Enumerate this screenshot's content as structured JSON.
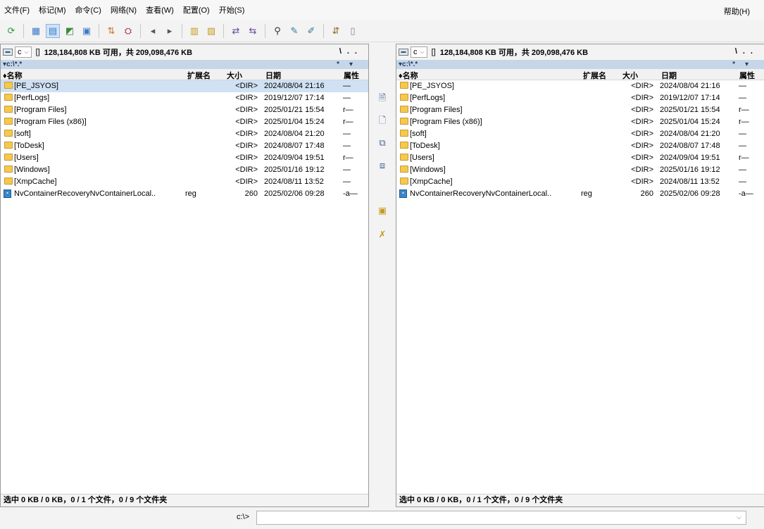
{
  "menu": [
    "文件(F)",
    "标记(M)",
    "命令(C)",
    "网络(N)",
    "查看(W)",
    "配置(O)",
    "开始(S)"
  ],
  "menu_help": "帮助(H)",
  "toolbar_icons": [
    "refresh-icon",
    "brief-view-icon",
    "full-view-icon",
    "tree-icon",
    "thumbnail-icon",
    "sort-icon",
    "filter-icon",
    "back-icon",
    "forward-icon",
    "pack-icon",
    "unpack-icon",
    "compare-icon",
    "sync-icon",
    "search-icon",
    "rename-icon",
    "multi-rename-icon",
    "ftp-icon",
    "notepad-icon"
  ],
  "left": {
    "drive": "c",
    "brackets": "[]",
    "info": "128,184,808 KB 可用，共 209,098,476 KB",
    "root_btn": "\\",
    "up_btn": "..",
    "path": "▾c:\\*.*",
    "star_btn": "*",
    "dd_btn": "▾",
    "headers": {
      "name": "♦名称",
      "ext": "扩展名",
      "size": "大小",
      "date": "日期",
      "attr": "属性"
    },
    "status": "选中 0 KB / 0 KB，0 / 1 个文件，0 / 9 个文件夹"
  },
  "right": {
    "drive": "c",
    "brackets": "[]",
    "info": "128,184,808 KB 可用，共 209,098,476 KB",
    "root_btn": "\\",
    "up_btn": "..",
    "path": "▾c:\\*.*",
    "star_btn": "*",
    "dd_btn": "▾",
    "headers": {
      "name": "♦名称",
      "ext": "扩展名",
      "size": "大小",
      "date": "日期",
      "attr": "属性"
    },
    "status": "选中 0 KB / 0 KB，0 / 1 个文件，0 / 9 个文件夹"
  },
  "files": [
    {
      "name": "[PE_JSYOS]",
      "ext": "",
      "size": "<DIR>",
      "date": "2024/08/04 21:16",
      "attr": "—",
      "type": "dir"
    },
    {
      "name": "[PerfLogs]",
      "ext": "",
      "size": "<DIR>",
      "date": "2019/12/07 17:14",
      "attr": "—",
      "type": "dir"
    },
    {
      "name": "[Program Files]",
      "ext": "",
      "size": "<DIR>",
      "date": "2025/01/21 15:54",
      "attr": "r—",
      "type": "dir"
    },
    {
      "name": "[Program Files (x86)]",
      "ext": "",
      "size": "<DIR>",
      "date": "2025/01/04 15:24",
      "attr": "r—",
      "type": "dir"
    },
    {
      "name": "[soft]",
      "ext": "",
      "size": "<DIR>",
      "date": "2024/08/04 21:20",
      "attr": "—",
      "type": "dir"
    },
    {
      "name": "[ToDesk]",
      "ext": "",
      "size": "<DIR>",
      "date": "2024/08/07 17:48",
      "attr": "—",
      "type": "dir"
    },
    {
      "name": "[Users]",
      "ext": "",
      "size": "<DIR>",
      "date": "2024/09/04 19:51",
      "attr": "r—",
      "type": "dir"
    },
    {
      "name": "[Windows]",
      "ext": "",
      "size": "<DIR>",
      "date": "2025/01/16 19:12",
      "attr": "—",
      "type": "dir"
    },
    {
      "name": "[XmpCache]",
      "ext": "",
      "size": "<DIR>",
      "date": "2024/08/11 13:52",
      "attr": "—",
      "type": "dir"
    },
    {
      "name": "NvContainerRecoveryNvContainerLocal..",
      "ext": "reg",
      "size": "260",
      "date": "2025/02/06 09:28",
      "attr": "-a—",
      "type": "file"
    }
  ],
  "middle_icons": [
    "view-file-icon",
    "edit-file-icon",
    "copy-icon",
    "move-icon",
    "new-folder-icon",
    "delete-icon"
  ],
  "cmd": {
    "label": "c:\\>",
    "value": ""
  }
}
